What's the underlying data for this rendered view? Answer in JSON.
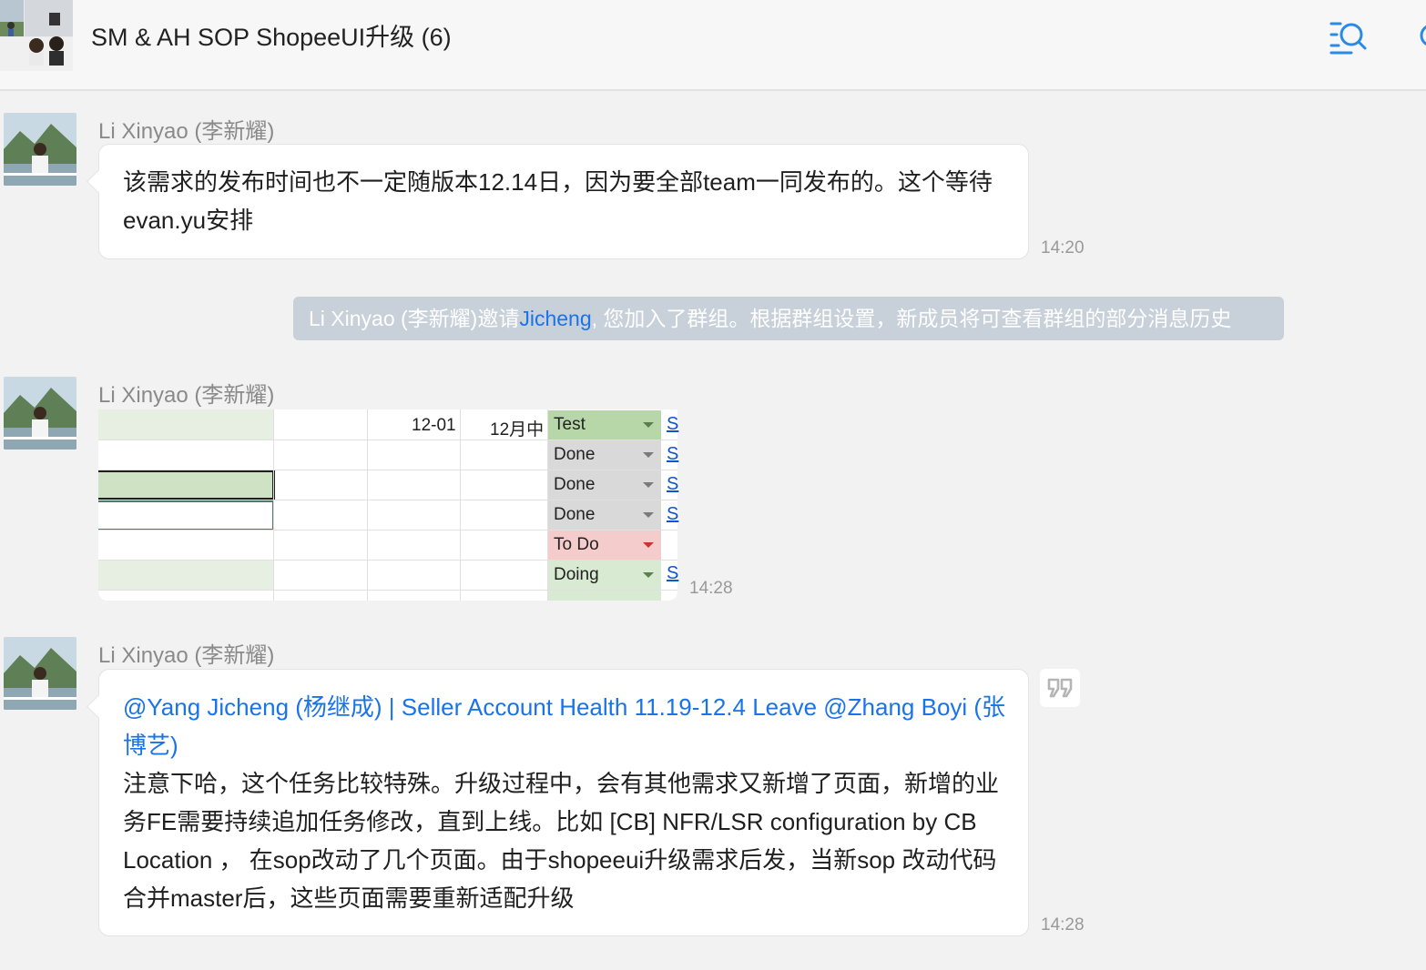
{
  "header": {
    "title": "SM & AH SOP ShopeeUI升级 (6)",
    "search_icon": "search-list-icon"
  },
  "messages": [
    {
      "sender": "Li Xinyao (李新耀)",
      "text": "该需求的发布时间也不一定随版本12.14日，因为要全部team一同发布的。这个等待evan.yu安排",
      "time": "14:20"
    },
    {
      "sender": "Li Xinyao (李新耀)",
      "time": "14:28",
      "sheet": {
        "row1": [
          "12-01",
          "12月中"
        ],
        "statuses": [
          "Test",
          "Done",
          "Done",
          "Done",
          "To Do",
          "Doing"
        ],
        "link_letter": "S",
        "status_colors": {
          "Test": "#b7d7a8",
          "Done": "#d9d9d9",
          "To Do": "#f4cccc",
          "Doing": "#d9ead3"
        }
      }
    },
    {
      "sender": "Li Xinyao (李新耀)",
      "mention": "@Yang Jicheng (杨继成) | Seller Account Health 11.19-12.4 Leave @Zhang Boyi  (张博艺)",
      "text": "注意下哈，这个任务比较特殊。升级过程中，会有其他需求又新增了页面，新增的业务FE需要持续追加任务修改，直到上线。比如 [CB] NFR/LSR configuration by CB Location ，  在sop改动了几个页面。由于shopeeui升级需求后发，当新sop 改动代码合并master后，这些页面需要重新适配升级",
      "time": "14:28"
    }
  ],
  "system_message": {
    "prefix": "Li Xinyao (李新耀)邀请",
    "link": "Jicheng",
    "suffix": ", 您加入了群组。根据群组设置，新成员将可查看群组的部分消息历史"
  },
  "colors": {
    "mention_blue": "#1a73e8",
    "system_bg": "#c8d0d9"
  }
}
